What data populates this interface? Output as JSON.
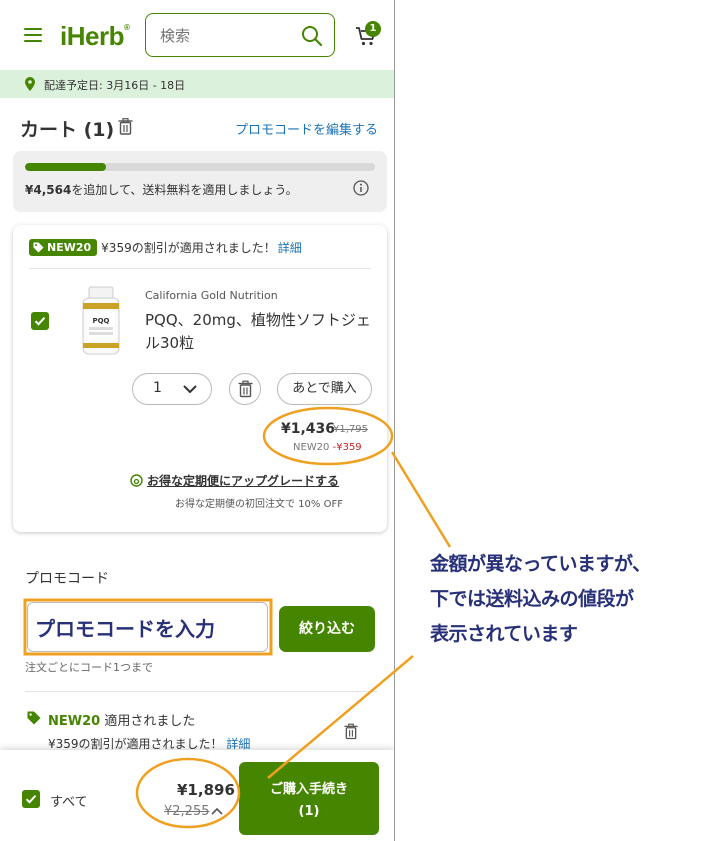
{
  "header": {
    "logo": "iHerb",
    "search_placeholder": "検索",
    "cart_count": "1"
  },
  "delivery": {
    "text": "配達予定日: 3月16日 - 18日"
  },
  "cart": {
    "title": "カート (1)",
    "edit_promo": "プロモコードを編集する"
  },
  "shipping": {
    "amount": "¥4,564",
    "message": "を追加して、送料無料を適用しましょう。",
    "progress_fraction": 0.23
  },
  "item": {
    "badge": "NEW20",
    "badge_message": "¥359の割引が適用されました！",
    "badge_link": "詳細",
    "brand": "California Gold Nutrition",
    "name": "PQQ、20mg、植物性ソフトジェル30粒",
    "image_label": "PQQ",
    "qty": "1",
    "later": "あとで購入",
    "price_now": "¥1,436",
    "price_was": "¥1,795",
    "price_code": "NEW20",
    "price_discount": "-¥359",
    "upgrade": "お得な定期便にアップグレードする",
    "upgrade_sub": "お得な定期便の初回注文で 10% OFF"
  },
  "promo": {
    "label": "プロモコード",
    "input_value": "プロモコードを入力",
    "apply": "絞り込む",
    "note": "注文ごとにコード1つまで",
    "applied_code": "NEW20",
    "applied_suffix": " 適用されました",
    "applied_desc": "¥359の割引が適用されました！",
    "applied_link": "詳細"
  },
  "bottom": {
    "all": "すべて",
    "total_now": "¥1,896",
    "total_was": "¥2,255",
    "checkout_line1": "ご購入手続き",
    "checkout_line2": "(1)"
  },
  "annotation": {
    "line1": "金額が異なっていますが、",
    "line2": "下では送料込みの値段が",
    "line3": "表示されています"
  },
  "colors": {
    "brand_green": "#458500",
    "link_blue": "#1a73b8",
    "callout_orange": "#f0a020",
    "annotation_navy": "#273078",
    "discount_red": "#c62828"
  }
}
